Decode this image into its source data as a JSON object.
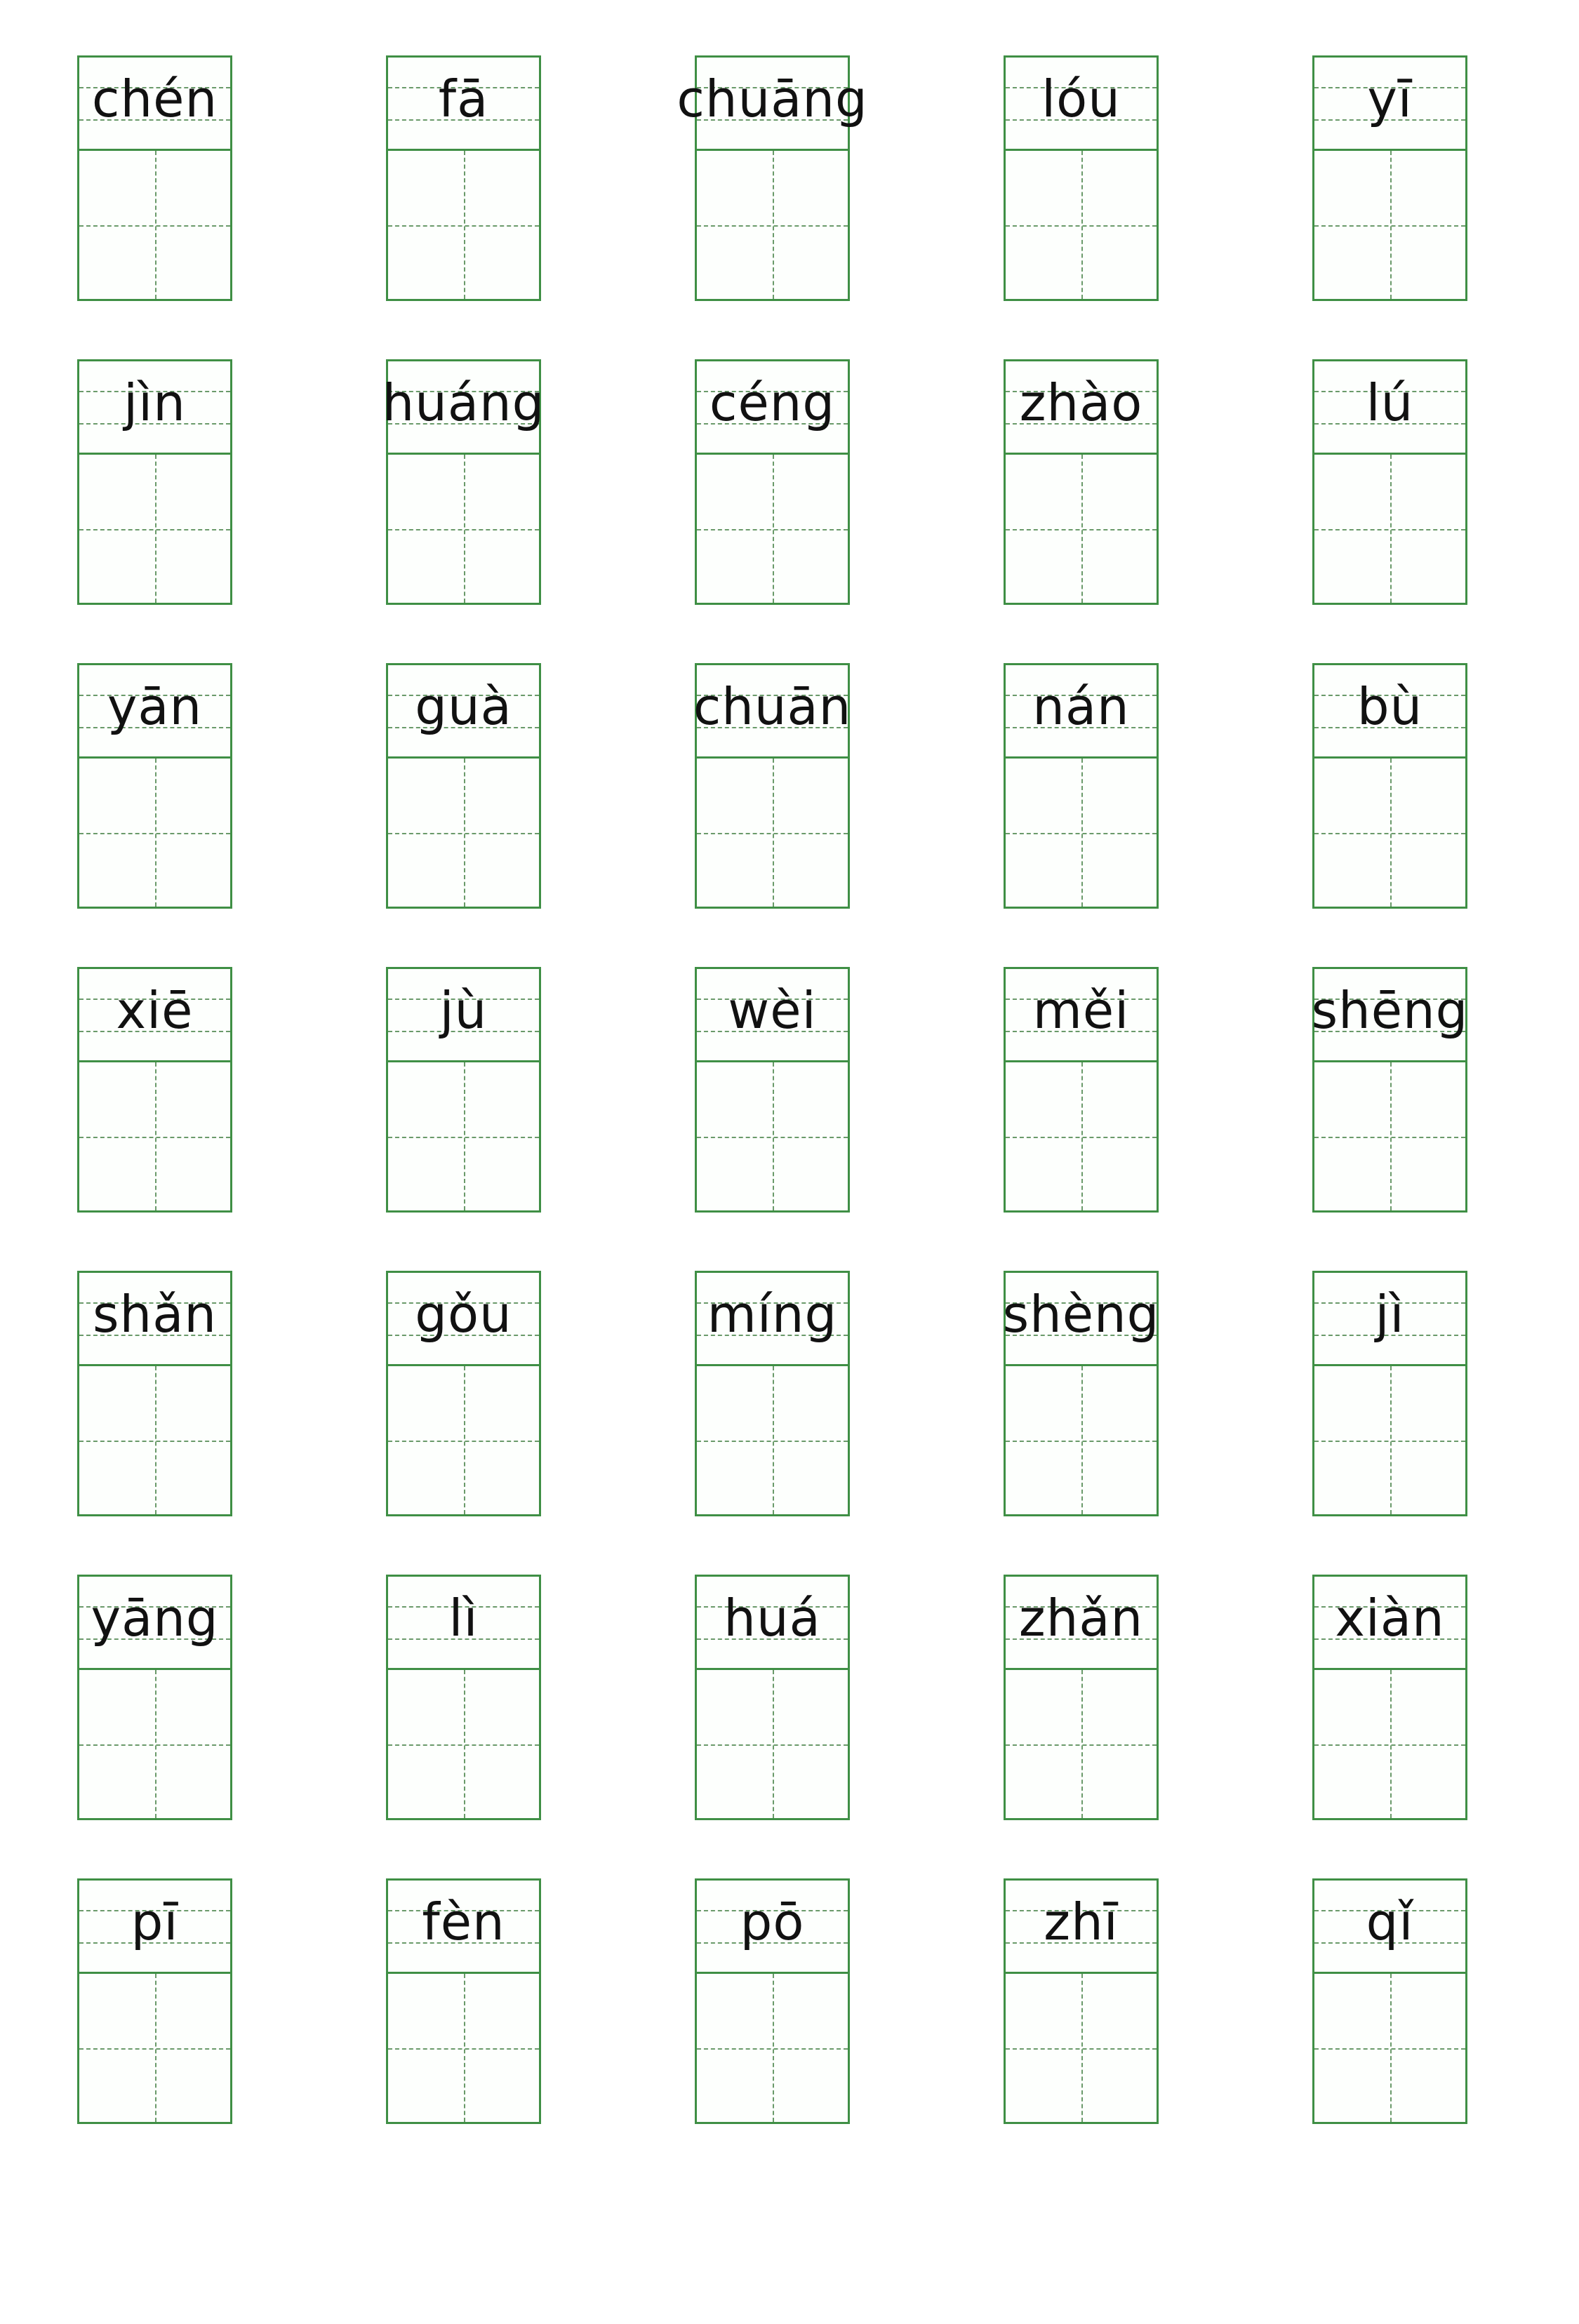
{
  "colors": {
    "grid_line": "#3f8f45",
    "text": "#111111"
  },
  "pinyin": [
    "chén",
    "fā",
    "chuāng",
    "lóu",
    "yī",
    "jìn",
    "huáng",
    "céng",
    "zhào",
    "lú",
    "yān",
    "guà",
    "chuān",
    "nán",
    "bù",
    "xiē",
    "jù",
    "wèi",
    "měi",
    "shēng",
    "shǎn",
    "gǒu",
    "míng",
    "shèng",
    "jì",
    "yāng",
    "lì",
    "huá",
    "zhǎn",
    "xiàn",
    "pī",
    "fèn",
    "pō",
    "zhī",
    "qǐ"
  ]
}
